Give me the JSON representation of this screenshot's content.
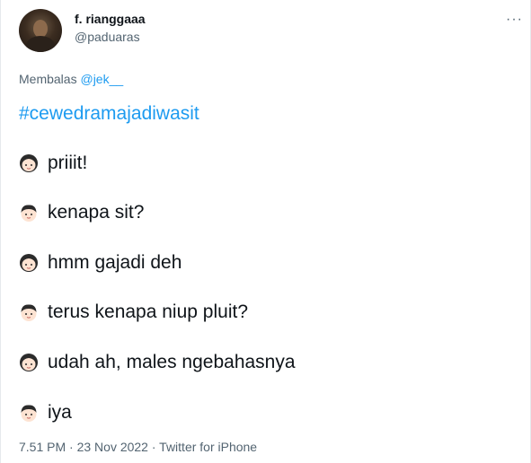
{
  "tweet": {
    "display_name": "f. rianggaaa",
    "handle": "@paduaras",
    "more_icon": "more-horizontal-icon",
    "reply_prefix": "Membalas",
    "reply_to": "@jek__",
    "hashtag": "#cewedramajadiwasit",
    "lines": [
      {
        "speaker": "girl-emoji",
        "text": "priiit!"
      },
      {
        "speaker": "boy-emoji",
        "text": "kenapa sit?"
      },
      {
        "speaker": "girl-emoji",
        "text": "hmm gajadi deh"
      },
      {
        "speaker": "boy-emoji",
        "text": "terus kenapa niup pluit?"
      },
      {
        "speaker": "girl-emoji",
        "text": "udah ah, males ngebahasnya"
      },
      {
        "speaker": "boy-emoji",
        "text": "iya"
      }
    ],
    "footer": "7.51 PM · 23 Nov 2022 · Twitter for iPhone"
  },
  "colors": {
    "link": "#1d9bf0",
    "secondary_text": "#536471",
    "primary_text": "#0f1419"
  }
}
